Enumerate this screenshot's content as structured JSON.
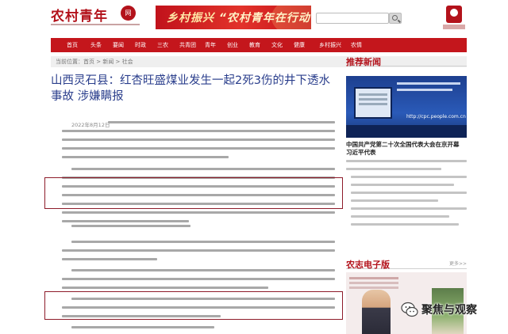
{
  "header": {
    "logo_title": "农村青年",
    "logo_seal": "网",
    "banner_part1": "乡村振兴 ",
    "banner_part2": "“农村青年在行动”"
  },
  "nav": {
    "items": [
      "首页",
      "头条",
      "要闻",
      "时政",
      "三农",
      "共青团",
      "青年",
      "创业",
      "教育",
      "文化",
      "健康",
      "乡村振兴",
      "农情"
    ]
  },
  "breadcrumb": {
    "text": "当前位置：首页 > 新闻 > 社会"
  },
  "article": {
    "title": "山西灵石县：红杏旺盛煤业发生一起2死3伤的井下透水事故 涉嫌瞒报",
    "date_lead": "2022年8月12日"
  },
  "sidebar": {
    "recommend_heading": "推荐新闻",
    "thumb_url": "http://cpc.people.com.cn",
    "recommend_title": "中国共产党第二十次全国代表大会在京开幕 习近平代表",
    "paper_heading": "农志电子版",
    "paper_more": "更多>>"
  },
  "watermark": {
    "text": "聚焦与观察"
  },
  "colors": {
    "brand_red": "#c4161c",
    "title_blue": "#2a3e8c",
    "highlight_box": "#8e1c2a"
  }
}
